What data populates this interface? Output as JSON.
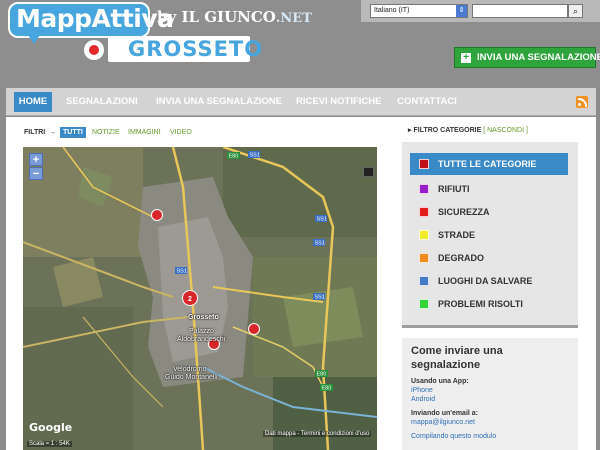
{
  "header": {
    "logo_text": "MappAttiva",
    "logo_by": "by",
    "logo_sponsor": "IL GIUNCO",
    "logo_sponsor_suffix": ".NET",
    "city": "GROSSETO",
    "language_selected": "Italiano (IT)",
    "search_placeholder": "",
    "report_button": "INVIA UNA SEGNALAZIONE"
  },
  "nav": {
    "items": [
      {
        "label": "HOME",
        "active": true
      },
      {
        "label": "SEGNALAZIONI",
        "active": false
      },
      {
        "label": "INVIA UNA SEGNALAZIONE",
        "active": false
      },
      {
        "label": "RICEVI NOTIFICHE",
        "active": false
      },
      {
        "label": "CONTATTACI",
        "active": false
      }
    ],
    "rss_icon": "rss-icon"
  },
  "filters": {
    "label": "FILTRI",
    "arrow": "→",
    "options": [
      "TUTTI",
      "NOTIZIE",
      "IMMAGINI",
      "VIDEO"
    ],
    "active": "TUTTI"
  },
  "map": {
    "zoom_in": "+",
    "zoom_out": "−",
    "city_label": "Grosseto",
    "place_label_1": "Palazzo",
    "place_label_2": "Aldobrandeschi",
    "place_label_3": "Velodromo",
    "place_label_4": "Guido Montanelli",
    "cluster_count": "2",
    "credit": "Dati mappa - Termini e condizioni d'uso",
    "google_logo": "Google",
    "scale": "Scala = 1 : 54K",
    "road_labels": [
      "E80",
      "SS1",
      "SS1",
      "SS1",
      "SS1",
      "SS1",
      "E80",
      "E80"
    ],
    "marker_color": "#d8262c"
  },
  "sidebar": {
    "filter_title": "FILTRO CATEGORIE",
    "filter_toggle": "[ NASCONDI ]",
    "categories": [
      {
        "label": "TUTTE LE CATEGORIE",
        "color": "#c0101a",
        "active": true
      },
      {
        "label": "RIFIUTI",
        "color": "#9a1fc8",
        "active": false
      },
      {
        "label": "SICUREZZA",
        "color": "#e21b1b",
        "active": false
      },
      {
        "label": "STRADE",
        "color": "#f1ec2b",
        "active": false
      },
      {
        "label": "DEGRADO",
        "color": "#f08a1e",
        "active": false
      },
      {
        "label": "LUOGHI DA SALVARE",
        "color": "#4a78c8",
        "active": false
      },
      {
        "label": "PROBLEMI RISOLTI",
        "color": "#2fd63a",
        "active": false
      }
    ],
    "how_title": "Come inviare una segnalazione",
    "via_app_label": "Usando una App:",
    "app_iphone": "iPhone",
    "app_android": "Android",
    "via_email_label": "Inviando un'email a:",
    "email": "mappa@ilgiunco.net",
    "form_link": "Compilando questo modulo"
  }
}
